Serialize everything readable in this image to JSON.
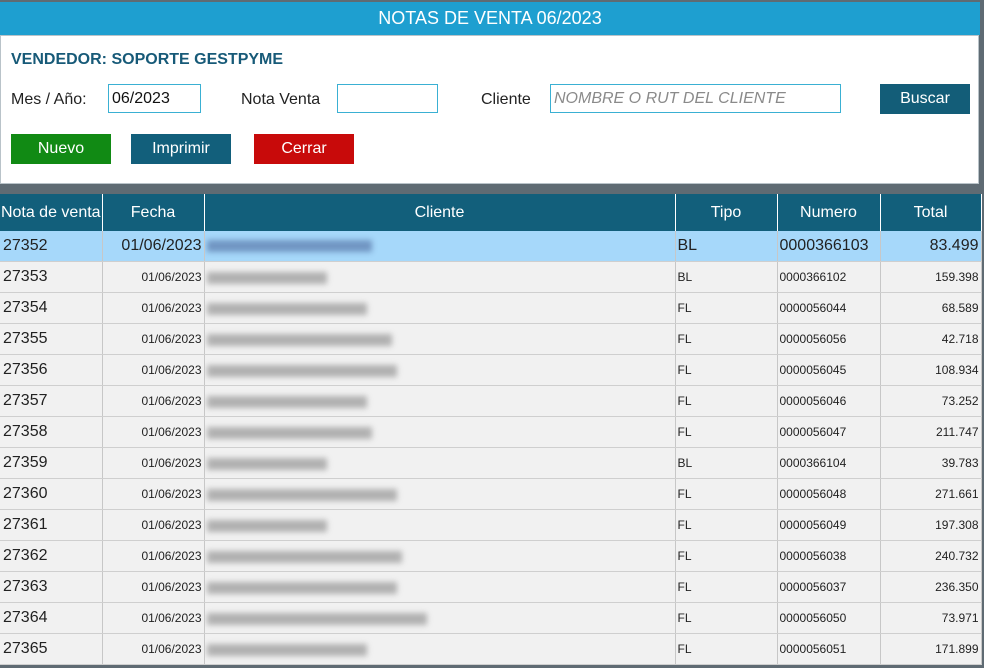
{
  "title": "NOTAS DE VENTA 06/2023",
  "seller": "VENDEDOR: SOPORTE GESTPYME",
  "filters": {
    "mes_label": "Mes / Año:",
    "mes_value": "06/2023",
    "nota_label": "Nota Venta",
    "nota_value": "",
    "cliente_label": "Cliente",
    "cliente_placeholder": "NOMBRE O RUT DEL CLIENTE",
    "buscar": "Buscar"
  },
  "actions": {
    "nuevo": "Nuevo",
    "imprimir": "Imprimir",
    "cerrar": "Cerrar"
  },
  "colors": {
    "title_bar": "#1e9fd0",
    "header": "#125f7b",
    "nuevo": "#118a14",
    "cerrar": "#c80a0a",
    "selected_row": "#a6d8fa"
  },
  "table": {
    "headers": [
      "Nota de venta",
      "Fecha",
      "Cliente",
      "Tipo",
      "Numero",
      "Total"
    ],
    "rows": [
      {
        "nota": "27352",
        "fecha": "01/06/2023",
        "tipo": "BL",
        "numero": "0000366103",
        "total": "83.499"
      },
      {
        "nota": "27353",
        "fecha": "01/06/2023",
        "tipo": "BL",
        "numero": "0000366102",
        "total": "159.398"
      },
      {
        "nota": "27354",
        "fecha": "01/06/2023",
        "tipo": "FL",
        "numero": "0000056044",
        "total": "68.589"
      },
      {
        "nota": "27355",
        "fecha": "01/06/2023",
        "tipo": "FL",
        "numero": "0000056056",
        "total": "42.718"
      },
      {
        "nota": "27356",
        "fecha": "01/06/2023",
        "tipo": "FL",
        "numero": "0000056045",
        "total": "108.934"
      },
      {
        "nota": "27357",
        "fecha": "01/06/2023",
        "tipo": "FL",
        "numero": "0000056046",
        "total": "73.252"
      },
      {
        "nota": "27358",
        "fecha": "01/06/2023",
        "tipo": "FL",
        "numero": "0000056047",
        "total": "211.747"
      },
      {
        "nota": "27359",
        "fecha": "01/06/2023",
        "tipo": "BL",
        "numero": "0000366104",
        "total": "39.783"
      },
      {
        "nota": "27360",
        "fecha": "01/06/2023",
        "tipo": "FL",
        "numero": "0000056048",
        "total": "271.661"
      },
      {
        "nota": "27361",
        "fecha": "01/06/2023",
        "tipo": "FL",
        "numero": "0000056049",
        "total": "197.308"
      },
      {
        "nota": "27362",
        "fecha": "01/06/2023",
        "tipo": "FL",
        "numero": "0000056038",
        "total": "240.732"
      },
      {
        "nota": "27363",
        "fecha": "01/06/2023",
        "tipo": "FL",
        "numero": "0000056037",
        "total": "236.350"
      },
      {
        "nota": "27364",
        "fecha": "01/06/2023",
        "tipo": "FL",
        "numero": "0000056050",
        "total": "73.971"
      },
      {
        "nota": "27365",
        "fecha": "01/06/2023",
        "tipo": "FL",
        "numero": "0000056051",
        "total": "171.899"
      }
    ]
  }
}
